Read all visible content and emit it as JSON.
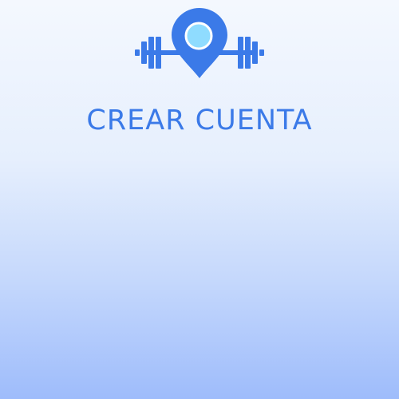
{
  "header": {
    "logo_icon": "dumbbell-location-pin-icon",
    "title": "CREAR CUENTA"
  },
  "colors": {
    "accent": "#3b7ae8",
    "pin_center": "#8fdcff",
    "background_top": "#f4f8fe",
    "background_bottom": "#9ebcfb"
  }
}
